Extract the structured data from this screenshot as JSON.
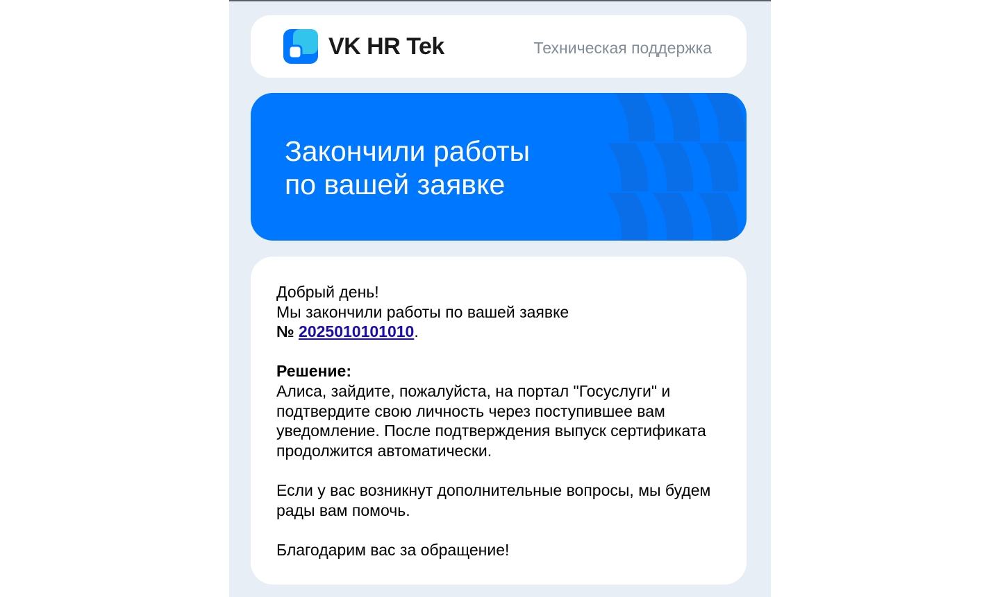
{
  "header": {
    "brand_name": "VK HR Tek",
    "support_label": "Техническая поддержка",
    "logo_icon": "vk-hr-tek-logo",
    "accent_color": "#0077ff"
  },
  "banner": {
    "line1": "Закончили работы",
    "line2": "по вашей заявке"
  },
  "message": {
    "greeting": "Добрый день!",
    "intro": "Мы закончили работы по вашей заявке",
    "ticket_prefix": "№ ",
    "ticket_number": "2025010101010",
    "ticket_suffix": ".",
    "solution_heading": "Решение:",
    "solution_text": "Алиса, зайдите, пожалуйста, на портал \"Госуслуги\" и подтвердите свою личность через поступившее вам уведомление. После подтверждения выпуск сертификата продолжится автоматически.",
    "help_text": "Если у вас возникнут дополнительные вопросы, мы будем рады вам помочь.",
    "closing": "Благодарим вас за обращение!"
  }
}
